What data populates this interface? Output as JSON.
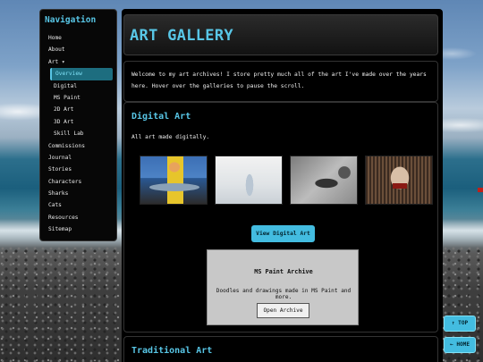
{
  "nav": {
    "title": "Navigation",
    "items": {
      "home": "Home",
      "about": "About",
      "art": "Art ▾",
      "overview": "Overview",
      "digital": "Digital",
      "ms_paint": "MS Paint",
      "art_2d": "2D Art",
      "art_3d": "3D Art",
      "skill_lab": "Skill Lab",
      "commissions": "Commissions",
      "journal": "Journal",
      "stories": "Stories",
      "characters": "Characters",
      "sharks": "Sharks",
      "cats": "Cats",
      "resources": "Resources",
      "sitemap": "Sitemap"
    }
  },
  "header": {
    "title": "ART GALLERY"
  },
  "intro": {
    "text": "Welcome to my art archives! I store pretty much all of the art I've made over the years here. Hover over the galleries to pause the scroll."
  },
  "digital": {
    "title": "Digital Art",
    "description": "All art made digitally.",
    "view_button": "View Digital Art",
    "ms_paint": {
      "title": "MS Paint Archive",
      "description": "Doodles and drawings made in MS Paint and more.",
      "button": "Open Archive"
    }
  },
  "traditional": {
    "title": "Traditional Art"
  },
  "floating": {
    "top": "↑ TOP",
    "home": "← HOME"
  },
  "colors": {
    "accent": "#58c6e6",
    "button": "#43bce0",
    "panel": "#000000"
  }
}
